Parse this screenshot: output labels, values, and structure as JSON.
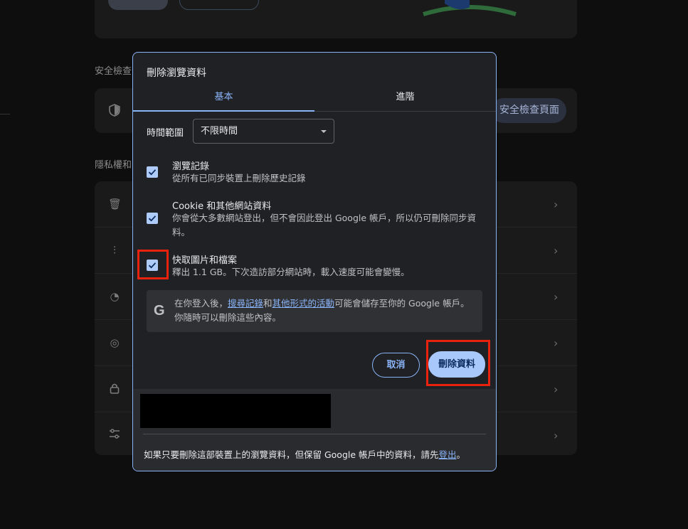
{
  "background": {
    "sections": [
      {
        "label": "安全檢查"
      },
      {
        "label": "隱私權和"
      }
    ],
    "safety_check_button": "安全檢查頁面"
  },
  "dialog": {
    "title": "刪除瀏覽資料",
    "tabs": [
      {
        "label": "基本",
        "selected": true
      },
      {
        "label": "進階",
        "selected": false
      }
    ],
    "time_range": {
      "label": "時間範圍",
      "value": "不限時間"
    },
    "options": [
      {
        "title": "瀏覽記錄",
        "desc": "從所有已同步裝置上刪除歷史記錄",
        "checked": true
      },
      {
        "title": "Cookie 和其他網站資料",
        "desc": "你會從大多數網站登出，但不會因此登出 Google 帳戶，所以仍可刪除同步資料。",
        "checked": true
      },
      {
        "title": "快取圖片和檔案",
        "desc": "釋出 1.1 GB。下次造訪部分網站時，載入速度可能會變慢。",
        "checked": true
      }
    ],
    "info": {
      "icon": "google-g-icon",
      "prefix": "在你登入後，",
      "link1": "搜尋記錄",
      "middle": "和",
      "link2": "其他形式的活動",
      "suffix": "可能會儲存至你的 Google 帳戶。你隨時可以刪除這些內容。"
    },
    "buttons": {
      "cancel": "取消",
      "delete": "刪除資料"
    },
    "footer": {
      "text": "如果只要刪除這部裝置上的瀏覽資料，但保留 Google 帳戶中的資料，請先",
      "link": "登出",
      "end": "。"
    }
  },
  "colors": {
    "accent": "#8ab4f8",
    "highlight": "#e8220c",
    "dialog_bg": "#202124"
  }
}
